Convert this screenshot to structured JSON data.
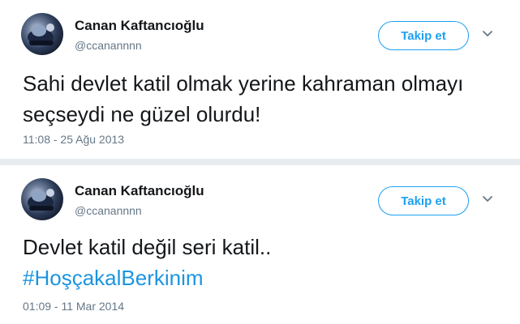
{
  "tweets": [
    {
      "display_name": "Canan Kaftancıoğlu",
      "handle": "@ccanannnn",
      "follow_label": "Takip et",
      "text": "Sahi devlet katil olmak yerine kahraman olmayı seçseydi ne güzel olurdu!",
      "timestamp": "11:08 - 25 Ağu 2013",
      "avatar_icon": "profile-photo",
      "menu_icon": "chevron-down-icon"
    },
    {
      "display_name": "Canan Kaftancıoğlu",
      "handle": "@ccanannnn",
      "follow_label": "Takip et",
      "text": "Devlet katil değil seri katil..",
      "hashtag": "#HoşçakalBerkinim",
      "timestamp": "01:09 - 11 Mar 2014",
      "avatar_icon": "profile-photo",
      "menu_icon": "chevron-down-icon"
    }
  ],
  "colors": {
    "accent": "#1da1f2",
    "hashtag": "#1b95e0",
    "secondary_text": "#657786",
    "primary_text": "#14171a",
    "separator": "#e6ecf0"
  }
}
